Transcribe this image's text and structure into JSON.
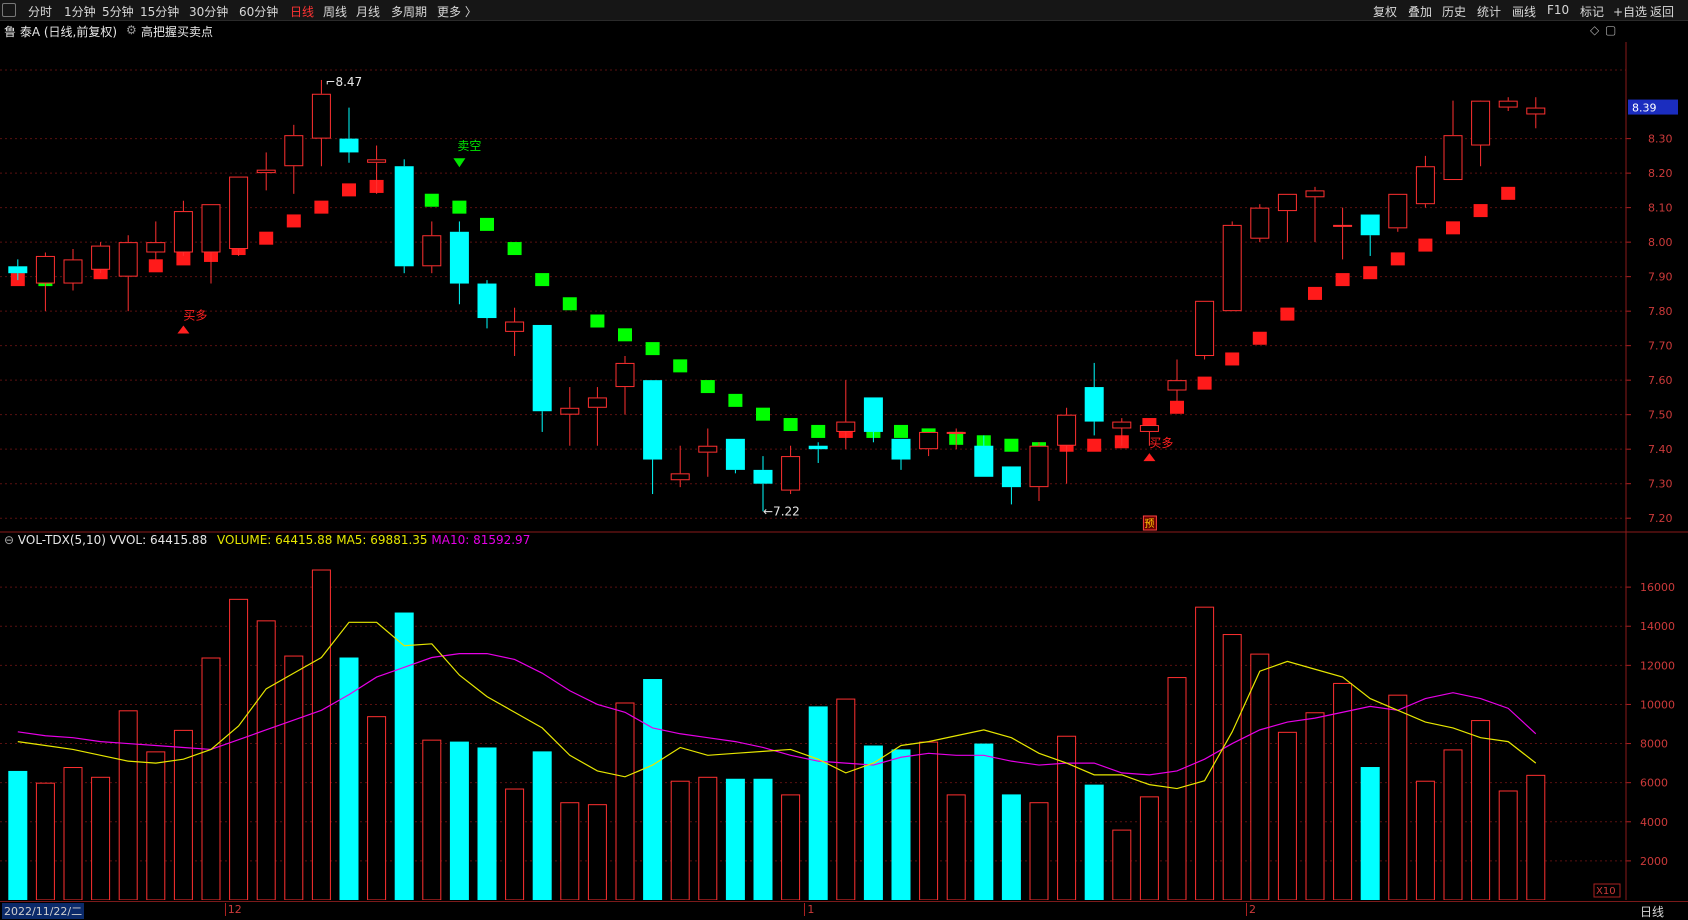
{
  "toolbar": {
    "left_tabs": [
      "分时",
      "1分钟",
      "5分钟",
      "15分钟",
      "30分钟",
      "60分钟",
      "日线",
      "周线",
      "月线",
      "多周期",
      "更多 〉"
    ],
    "active_tab": "日线",
    "right_tabs": [
      "复权",
      "叠加",
      "历史",
      "统计",
      "画线",
      "F10",
      "标记",
      "+自选",
      "返回"
    ]
  },
  "title": {
    "stock": "鲁 泰A (日线,前复权)",
    "indicator": "高把握买卖点"
  },
  "colors": {
    "up": "#ff3030",
    "down": "#00ffff",
    "buy_signal": "#ff1a1a",
    "sell_signal": "#00ff00",
    "ma5": "#e6e600",
    "ma10": "#e600e6",
    "grid": "#5a1010"
  },
  "chart_data": [
    {
      "type": "candlestick",
      "title": "鲁 泰A (日线,前复权)",
      "ylim": [
        7.16,
        8.58
      ],
      "y_ticks": [
        "8.30",
        "8.20",
        "8.10",
        "8.00",
        "7.90",
        "7.80",
        "7.70",
        "7.60",
        "7.50",
        "7.40",
        "7.30",
        "7.20"
      ],
      "current_price": "8.39",
      "ohlc": [
        [
          7.93,
          7.95,
          7.89,
          7.91
        ],
        [
          7.88,
          7.97,
          7.8,
          7.96
        ],
        [
          7.88,
          7.98,
          7.86,
          7.95
        ],
        [
          7.92,
          8.0,
          7.91,
          7.99
        ],
        [
          7.9,
          8.02,
          7.8,
          8.0
        ],
        [
          7.97,
          8.06,
          7.95,
          8.0
        ],
        [
          7.97,
          8.12,
          7.96,
          8.09
        ],
        [
          7.97,
          8.11,
          7.88,
          8.11
        ],
        [
          7.98,
          8.19,
          7.96,
          8.19
        ],
        [
          8.2,
          8.26,
          8.15,
          8.21
        ],
        [
          8.22,
          8.34,
          8.14,
          8.31
        ],
        [
          8.3,
          8.47,
          8.22,
          8.43
        ],
        [
          8.3,
          8.39,
          8.23,
          8.26
        ],
        [
          8.23,
          8.28,
          8.14,
          8.24
        ],
        [
          8.22,
          8.24,
          7.91,
          7.93
        ],
        [
          7.93,
          8.06,
          7.91,
          8.02
        ],
        [
          8.03,
          8.06,
          7.82,
          7.88
        ],
        [
          7.88,
          7.89,
          7.75,
          7.78
        ],
        [
          7.74,
          7.81,
          7.67,
          7.77
        ],
        [
          7.76,
          7.76,
          7.45,
          7.51
        ],
        [
          7.5,
          7.58,
          7.41,
          7.52
        ],
        [
          7.52,
          7.58,
          7.41,
          7.55
        ],
        [
          7.58,
          7.67,
          7.5,
          7.65
        ],
        [
          7.6,
          7.6,
          7.27,
          7.37
        ],
        [
          7.31,
          7.41,
          7.29,
          7.33
        ],
        [
          7.39,
          7.46,
          7.32,
          7.41
        ],
        [
          7.43,
          7.43,
          7.33,
          7.34
        ],
        [
          7.34,
          7.38,
          7.22,
          7.3
        ],
        [
          7.28,
          7.41,
          7.27,
          7.38
        ],
        [
          7.41,
          7.42,
          7.36,
          7.4
        ],
        [
          7.45,
          7.6,
          7.4,
          7.48
        ],
        [
          7.55,
          7.55,
          7.42,
          7.45
        ],
        [
          7.43,
          7.43,
          7.34,
          7.37
        ],
        [
          7.4,
          7.45,
          7.38,
          7.45
        ],
        [
          7.45,
          7.46,
          7.4,
          7.45
        ],
        [
          7.41,
          7.44,
          7.32,
          7.32
        ],
        [
          7.35,
          7.35,
          7.24,
          7.29
        ],
        [
          7.29,
          7.42,
          7.25,
          7.41
        ],
        [
          7.41,
          7.52,
          7.3,
          7.5
        ],
        [
          7.58,
          7.65,
          7.44,
          7.48
        ],
        [
          7.46,
          7.49,
          7.41,
          7.48
        ],
        [
          7.45,
          7.47,
          7.41,
          7.47
        ],
        [
          7.57,
          7.66,
          7.54,
          7.6
        ],
        [
          7.67,
          7.83,
          7.66,
          7.83
        ],
        [
          7.8,
          8.06,
          7.8,
          8.05
        ],
        [
          8.01,
          8.11,
          8.0,
          8.1
        ],
        [
          8.09,
          8.14,
          8.0,
          8.14
        ],
        [
          8.13,
          8.16,
          8.0,
          8.15
        ],
        [
          8.05,
          8.1,
          7.95,
          8.05
        ],
        [
          8.08,
          8.08,
          7.96,
          8.02
        ],
        [
          8.04,
          8.14,
          8.03,
          8.14
        ],
        [
          8.11,
          8.25,
          8.1,
          8.22
        ],
        [
          8.18,
          8.41,
          8.18,
          8.31
        ],
        [
          8.28,
          8.39,
          8.22,
          8.41
        ],
        [
          8.39,
          8.42,
          8.38,
          8.41
        ],
        [
          8.37,
          8.42,
          8.33,
          8.39
        ]
      ],
      "signal_line": [
        [
          7.89,
          "up"
        ],
        [
          7.89,
          "down"
        ],
        [
          7.9,
          "up"
        ],
        [
          7.91,
          "up"
        ],
        [
          7.92,
          "up"
        ],
        [
          7.93,
          "up"
        ],
        [
          7.95,
          "up"
        ],
        [
          7.96,
          "up"
        ],
        [
          7.98,
          "up"
        ],
        [
          8.01,
          "up"
        ],
        [
          8.06,
          "up"
        ],
        [
          8.1,
          "up"
        ],
        [
          8.15,
          "up"
        ],
        [
          8.16,
          "up"
        ],
        [
          8.14,
          "down"
        ],
        [
          8.12,
          "down"
        ],
        [
          8.1,
          "down"
        ],
        [
          8.05,
          "down"
        ],
        [
          7.98,
          "down"
        ],
        [
          7.89,
          "down"
        ],
        [
          7.82,
          "down"
        ],
        [
          7.77,
          "down"
        ],
        [
          7.73,
          "down"
        ],
        [
          7.69,
          "down"
        ],
        [
          7.64,
          "down"
        ],
        [
          7.58,
          "down"
        ],
        [
          7.54,
          "down"
        ],
        [
          7.5,
          "down"
        ],
        [
          7.47,
          "down"
        ],
        [
          7.45,
          "down"
        ],
        [
          7.45,
          "up"
        ],
        [
          7.45,
          "down"
        ],
        [
          7.45,
          "down"
        ],
        [
          7.44,
          "down"
        ],
        [
          7.43,
          "down"
        ],
        [
          7.42,
          "down"
        ],
        [
          7.41,
          "down"
        ],
        [
          7.4,
          "down"
        ],
        [
          7.41,
          "up"
        ],
        [
          7.41,
          "up"
        ],
        [
          7.42,
          "up"
        ],
        [
          7.47,
          "up"
        ],
        [
          7.52,
          "up"
        ],
        [
          7.59,
          "up"
        ],
        [
          7.66,
          "up"
        ],
        [
          7.72,
          "up"
        ],
        [
          7.79,
          "up"
        ],
        [
          7.85,
          "up"
        ],
        [
          7.89,
          "up"
        ],
        [
          7.91,
          "up"
        ],
        [
          7.95,
          "up"
        ],
        [
          7.99,
          "up"
        ],
        [
          8.04,
          "up"
        ],
        [
          8.09,
          "up"
        ],
        [
          8.14,
          "up"
        ]
      ],
      "annotations": [
        {
          "index": 11,
          "text": "8.47",
          "kind": "high"
        },
        {
          "index": 27,
          "text": "←7.22",
          "kind": "low"
        },
        {
          "index": 6,
          "text": "买多",
          "kind": "buy",
          "price": 7.77
        },
        {
          "index": 41,
          "text": "买多",
          "kind": "buy",
          "price": 7.4
        },
        {
          "index": 16,
          "text": "卖空",
          "kind": "sell",
          "price": 8.22
        }
      ],
      "marker_label": "预"
    },
    {
      "type": "bar",
      "title": "VOL-TDX(5,10)",
      "readout": {
        "vvol": "VVOL: 64415.88",
        "volume": "VOLUME: 64415.88",
        "ma5": "MA5: 69881.35",
        "ma10": "MA10: 81592.97"
      },
      "ylim": [
        0,
        18000
      ],
      "y_ticks": [
        "16000",
        "14000",
        "12000",
        "10000",
        "8000",
        "6000",
        "4000",
        "2000"
      ],
      "unit_label": "X10",
      "values": [
        6600,
        6000,
        6800,
        6300,
        9700,
        7600,
        8700,
        12400,
        15400,
        14300,
        12500,
        16900,
        12400,
        9400,
        14700,
        8200,
        8100,
        7800,
        5700,
        7600,
        5000,
        4900,
        10100,
        11300,
        6100,
        6300,
        6200,
        6200,
        5400,
        9900,
        10300,
        7900,
        7700,
        8100,
        5400,
        8000,
        5400,
        5000,
        8400,
        5900,
        3600,
        5300,
        11400,
        15000,
        13600,
        12600,
        8600,
        9600,
        11100,
        6800,
        10500,
        6100,
        7700,
        9200,
        5600,
        6400
      ],
      "ma5": [
        8100,
        7900,
        7700,
        7400,
        7100,
        7000,
        7200,
        7700,
        8900,
        10800,
        11600,
        12400,
        14200,
        14200,
        13000,
        13100,
        11500,
        10400,
        9600,
        8800,
        7400,
        6600,
        6300,
        6900,
        7800,
        7400,
        7500,
        7600,
        7700,
        7200,
        6500,
        7000,
        7900,
        8100,
        8400,
        8700,
        8300,
        7500,
        7000,
        6400,
        6400,
        5900,
        5700,
        6100,
        8600,
        11700,
        12200,
        11800,
        11400,
        10300,
        9700,
        9100,
        8800,
        8300,
        8100,
        7000
      ],
      "ma10": [
        8600,
        8400,
        8300,
        8100,
        8000,
        7900,
        7800,
        7700,
        8200,
        8700,
        9200,
        9700,
        10500,
        11400,
        11900,
        12400,
        12600,
        12600,
        12300,
        11600,
        10700,
        10000,
        9600,
        8800,
        8500,
        8300,
        8100,
        7800,
        7400,
        7100,
        7000,
        6900,
        7300,
        7500,
        7400,
        7400,
        7100,
        6900,
        7000,
        7000,
        6500,
        6400,
        6600,
        7200,
        8000,
        8700,
        9100,
        9300,
        9600,
        9900,
        9700,
        10300,
        10600,
        10300,
        9800,
        8500
      ]
    }
  ],
  "bottom": {
    "date": "2022/11/22/二",
    "month_labels": [
      {
        "index": 8,
        "text": "12"
      },
      {
        "index": 29,
        "text": "1"
      },
      {
        "index": 45,
        "text": "2"
      }
    ],
    "period": "日线"
  }
}
